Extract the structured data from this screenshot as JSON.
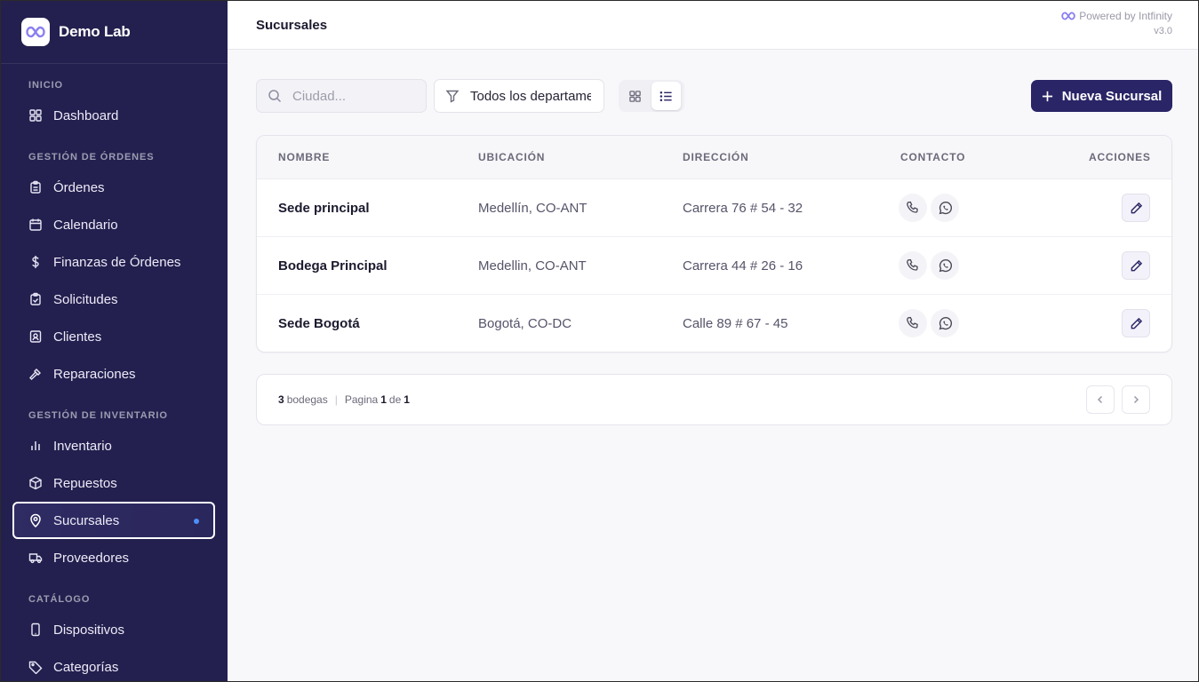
{
  "brand": {
    "name": "Demo Lab"
  },
  "header": {
    "title": "Sucursales",
    "powered_by": "Powered by Intfinity",
    "version": "v3.0"
  },
  "sidebar": {
    "sections": [
      {
        "label": "INICIO"
      },
      {
        "label": "GESTIÓN DE ÓRDENES"
      },
      {
        "label": "GESTIÓN DE INVENTARIO"
      },
      {
        "label": "CATÁLOGO"
      }
    ],
    "items": [
      {
        "label": "Dashboard",
        "icon": "dashboard-icon"
      },
      {
        "label": "Órdenes",
        "icon": "clipboard-icon"
      },
      {
        "label": "Calendario",
        "icon": "calendar-icon"
      },
      {
        "label": "Finanzas de Órdenes",
        "icon": "dollar-icon"
      },
      {
        "label": "Solicitudes",
        "icon": "clipboard-check-icon"
      },
      {
        "label": "Clientes",
        "icon": "contact-icon"
      },
      {
        "label": "Reparaciones",
        "icon": "hammer-icon"
      },
      {
        "label": "Inventario",
        "icon": "bar-chart-icon"
      },
      {
        "label": "Repuestos",
        "icon": "package-icon"
      },
      {
        "label": "Sucursales",
        "icon": "map-pin-icon",
        "active": true
      },
      {
        "label": "Proveedores",
        "icon": "truck-icon"
      },
      {
        "label": "Dispositivos",
        "icon": "smartphone-icon"
      },
      {
        "label": "Categorías",
        "icon": "tag-icon"
      }
    ]
  },
  "toolbar": {
    "search_placeholder": "Ciudad...",
    "department_filter": "Todos los departamentos",
    "new_button": "Nueva Sucursal"
  },
  "table": {
    "columns": [
      "NOMBRE",
      "UBICACIÓN",
      "DIRECCIÓN",
      "CONTACTO",
      "ACCIONES"
    ],
    "rows": [
      {
        "name": "Sede principal",
        "location": "Medellín, CO-ANT",
        "address": "Carrera 76 # 54 - 32"
      },
      {
        "name": "Bodega Principal",
        "location": "Medellin, CO-ANT",
        "address": "Carrera 44 # 26 - 16"
      },
      {
        "name": "Sede Bogotá",
        "location": "Bogotá, CO-DC",
        "address": "Calle 89 # 67 - 45"
      }
    ]
  },
  "pagination": {
    "count": "3",
    "count_label": "bodegas",
    "page_label": "Pagina",
    "current": "1",
    "of_label": "de",
    "total": "1"
  },
  "colors": {
    "sidebar_bg": "#23204f",
    "primary": "#2a2566",
    "active_dot": "#4f8ff7"
  }
}
